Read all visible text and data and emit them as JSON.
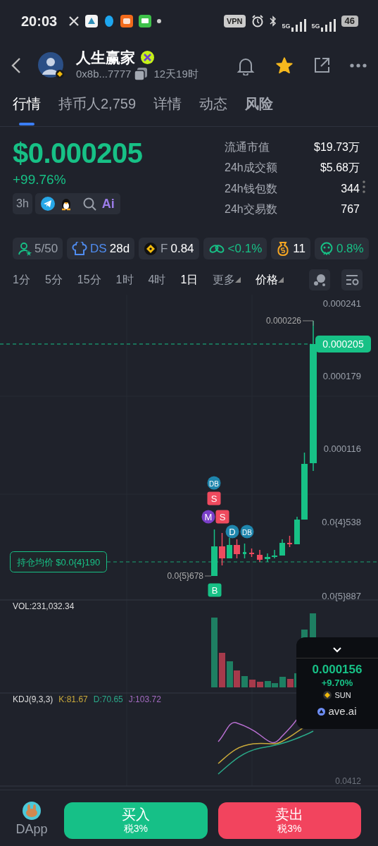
{
  "status_bar": {
    "time": "20:03",
    "vpn": "VPN",
    "network": [
      "5G",
      "5G"
    ],
    "battery": "46"
  },
  "token": {
    "name": "人生赢家",
    "address": "0x8b...7777",
    "age": "12天19时",
    "favorited": true
  },
  "tabs": [
    {
      "label": "行情",
      "selected": true,
      "bold": false
    },
    {
      "label": "持币人2,759",
      "selected": false,
      "bold": false
    },
    {
      "label": "详情",
      "selected": false,
      "bold": false
    },
    {
      "label": "动态",
      "selected": false,
      "bold": false
    },
    {
      "label": "风险",
      "selected": false,
      "bold": true
    }
  ],
  "price": {
    "value": "$0.000205",
    "change": "+99.76%",
    "age_chip": "3h",
    "ai": "Ai"
  },
  "stats": [
    {
      "label": "流通市值",
      "value": "$19.73万"
    },
    {
      "label": "24h成交额",
      "value": "$5.68万"
    },
    {
      "label": "24h钱包数",
      "value": "344"
    },
    {
      "label": "24h交易数",
      "value": "767"
    }
  ],
  "tags": [
    {
      "kind": "holders",
      "text": "5/50"
    },
    {
      "kind": "dev",
      "prefix": "DS",
      "text": "28d"
    },
    {
      "kind": "fee",
      "prefix": "F",
      "text": "0.84"
    },
    {
      "kind": "bundle",
      "text": "<0.1%"
    },
    {
      "kind": "money",
      "text": "11"
    },
    {
      "kind": "rat",
      "text": "0.8%"
    }
  ],
  "intervals": [
    {
      "label": "1分",
      "selected": false
    },
    {
      "label": "5分",
      "selected": false
    },
    {
      "label": "15分",
      "selected": false
    },
    {
      "label": "1时",
      "selected": false
    },
    {
      "label": "4时",
      "selected": false
    },
    {
      "label": "1日",
      "selected": true
    }
  ],
  "more": "更多",
  "mode": "价格",
  "chart": {
    "price_axis": [
      "0.000241",
      "0.000179",
      "0.000116",
      "0.0{4}538",
      "0.0{5}887"
    ],
    "last_price": "0.000205",
    "high": "0.000226",
    "low": "0.0{5}678",
    "avg_cost": "持仓均价 $0.0{4}190",
    "markers": [
      {
        "label": "DB",
        "kind": "circle",
        "color": "#1f86ad"
      },
      {
        "label": "S",
        "kind": "square",
        "color": "#ef4a5e"
      },
      {
        "label": "M",
        "kind": "circle",
        "color": "#7a3fc8"
      },
      {
        "label": "S",
        "kind": "square",
        "color": "#ef4a5e"
      },
      {
        "label": "D",
        "kind": "circle",
        "color": "#1f86ad"
      },
      {
        "label": "DB",
        "kind": "circle",
        "color": "#1f86ad"
      },
      {
        "label": "B",
        "kind": "square",
        "color": "#17c186"
      }
    ]
  },
  "volume": {
    "label": "VOL:231,032.34"
  },
  "kdj": {
    "label": "KDJ(9,3,3)",
    "k": "K:81.67",
    "d": "D:70.65",
    "j": "J:103.72",
    "axis": "0.0412"
  },
  "ticker": {
    "price": "0.000156",
    "change": "+9.70%",
    "symbol": "SUN",
    "source": "ave.ai"
  },
  "footer": {
    "dapp": "DApp",
    "buttons": [
      {
        "kind": "buy",
        "label": "买入",
        "tax": "税3%"
      },
      {
        "kind": "sell",
        "label": "卖出",
        "tax": "税3%"
      }
    ]
  }
}
